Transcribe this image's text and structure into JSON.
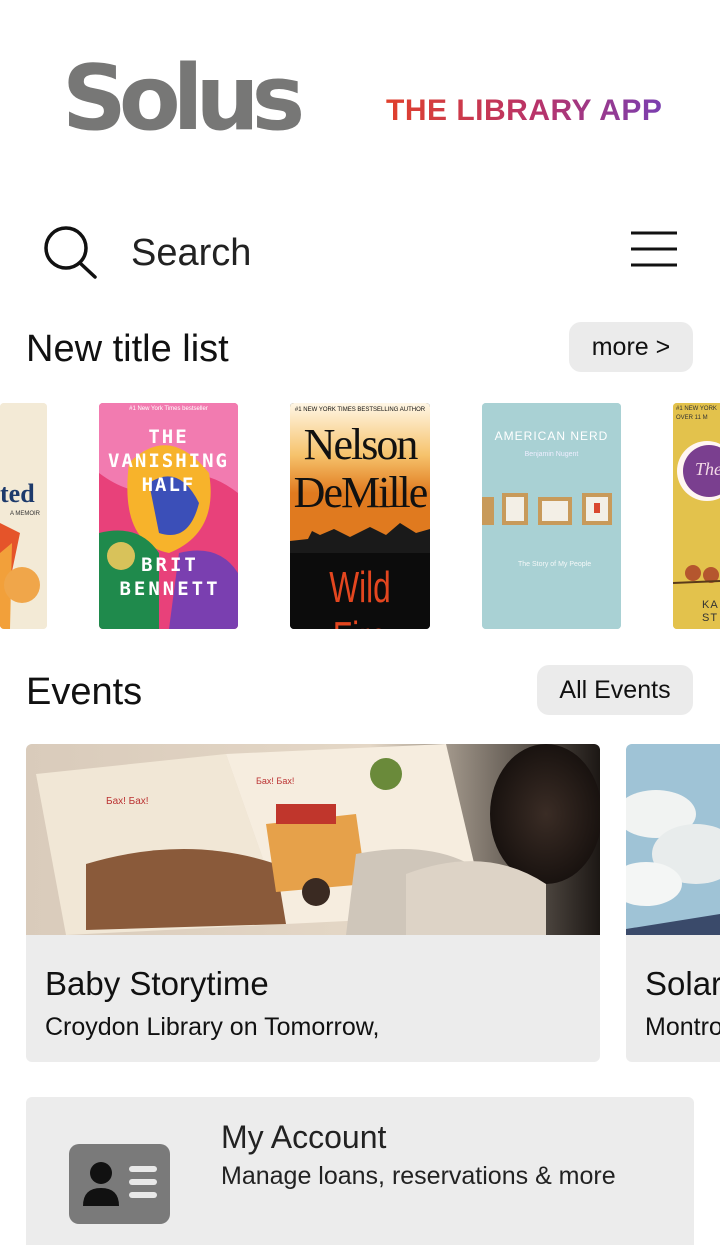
{
  "header": {
    "logo_text": "Solus",
    "tagline": "THE LIBRARY APP"
  },
  "search": {
    "placeholder": "Search",
    "icon": "search-icon",
    "menu_icon": "hamburger-menu-icon"
  },
  "new_titles": {
    "title": "New title list",
    "more_label": "more >",
    "books": [
      {
        "cover_text": "ted",
        "cover_sub": "A MEMOIR",
        "color": "#f3ead6"
      },
      {
        "cover_text": "THE VANISHING HALF",
        "author": "BRIT BENNETT",
        "top_line": "#1 New York Times bestseller",
        "color": "#e8417a"
      },
      {
        "cover_text": "Wild Fire",
        "author": "Nelson DeMille",
        "top_line": "#1 NEW YORK TIMES BESTSELLING AUTHOR",
        "color": "#0c0c0c"
      },
      {
        "cover_text": "AMERICAN NERD",
        "author": "Benjamin Nugent",
        "subtitle": "The Story of My People",
        "color": "#a9d1d4"
      },
      {
        "cover_text": "The",
        "author": "KA ST",
        "top_line": "#1 NEW YORK OVER 11 M",
        "color": "#e3c24c"
      }
    ]
  },
  "events": {
    "title": "Events",
    "all_label": "All Events",
    "cards": [
      {
        "title": "Baby Storytime",
        "subtitle": "Croydon Library on Tomorrow,"
      },
      {
        "title": "Solar",
        "subtitle": "Montrose"
      }
    ]
  },
  "account": {
    "title": "My Account",
    "subtitle": "Manage loans, reservations & more",
    "icon": "id-card-icon"
  },
  "colors": {
    "pill_bg": "#ebebeb",
    "card_bg": "#ececec",
    "logo_gray": "#777776",
    "tagline_start": "#e0402c",
    "tagline_end": "#7a3fb0"
  }
}
